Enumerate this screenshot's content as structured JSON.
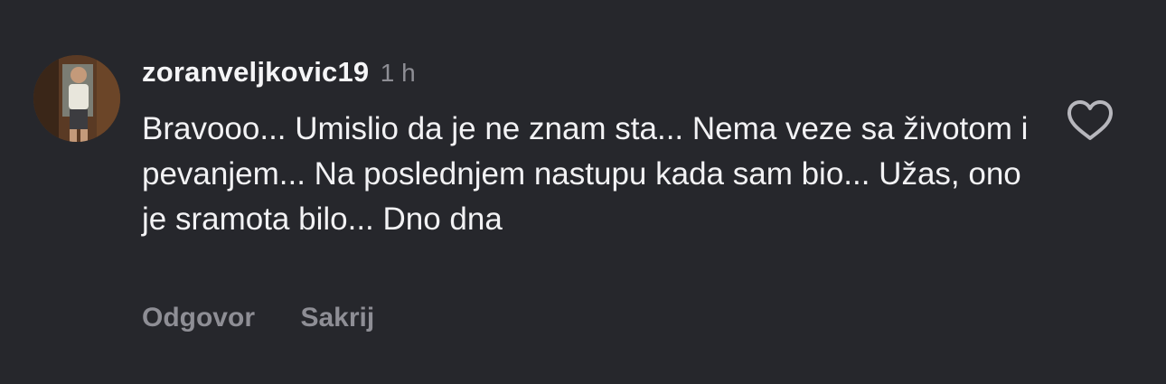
{
  "comment": {
    "username": "zoranveljkovic19",
    "time": "1 h",
    "text": "Bravooo... Umislio da je ne znam sta... Nema veze sa životom i pevanjem... Na poslednjem nastupu kada sam bio... Užas, ono je sramota bilo... Dno dna",
    "actions": {
      "reply": "Odgovor",
      "hide": "Sakrij"
    },
    "like_icon": "heart-outline-icon"
  },
  "colors": {
    "background": "#26272c",
    "text": "#f2f2f4",
    "muted": "#8e8e95"
  }
}
